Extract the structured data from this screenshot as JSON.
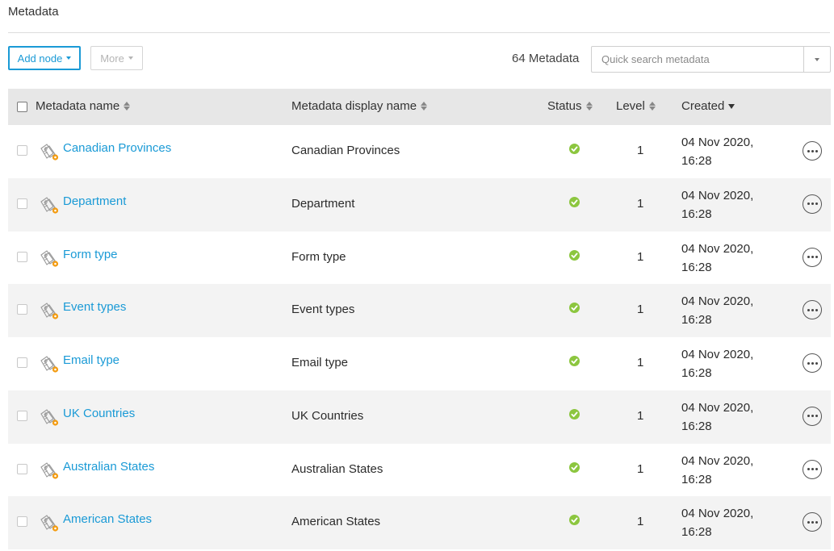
{
  "page": {
    "title": "Metadata"
  },
  "toolbar": {
    "add_node_label": "Add node",
    "more_label": "More",
    "count_label": "64 Metadata",
    "search_placeholder": "Quick search metadata"
  },
  "table": {
    "columns": {
      "name": "Metadata name",
      "display_name": "Metadata display name",
      "status": "Status",
      "level": "Level",
      "created": "Created"
    },
    "sort": {
      "column": "created",
      "direction": "descending"
    },
    "rows": [
      {
        "name": "Canadian Provinces",
        "display_name": "Canadian Provinces",
        "status": "ok",
        "level": "1",
        "created_date": "04 Nov 2020,",
        "created_time": "16:28"
      },
      {
        "name": "Department",
        "display_name": "Department",
        "status": "ok",
        "level": "1",
        "created_date": "04 Nov 2020,",
        "created_time": "16:28"
      },
      {
        "name": "Form type",
        "display_name": "Form type",
        "status": "ok",
        "level": "1",
        "created_date": "04 Nov 2020,",
        "created_time": "16:28"
      },
      {
        "name": "Event types",
        "display_name": "Event types",
        "status": "ok",
        "level": "1",
        "created_date": "04 Nov 2020,",
        "created_time": "16:28"
      },
      {
        "name": "Email type",
        "display_name": "Email type",
        "status": "ok",
        "level": "1",
        "created_date": "04 Nov 2020,",
        "created_time": "16:28"
      },
      {
        "name": "UK Countries",
        "display_name": "UK Countries",
        "status": "ok",
        "level": "1",
        "created_date": "04 Nov 2020,",
        "created_time": "16:28"
      },
      {
        "name": "Australian States",
        "display_name": "Australian States",
        "status": "ok",
        "level": "1",
        "created_date": "04 Nov 2020,",
        "created_time": "16:28"
      },
      {
        "name": "American States",
        "display_name": "American States",
        "status": "ok",
        "level": "1",
        "created_date": "04 Nov 2020,",
        "created_time": "16:28"
      }
    ]
  },
  "icons": {
    "row_icon": "metadata-tag-icon",
    "status_icon": "check-circle-icon",
    "actions_icon": "ellipsis-circle-icon"
  },
  "colors": {
    "accent": "#1a9ad6",
    "status_ok": "#8cc63f",
    "tag_badge": "#f39c12",
    "header_bg": "#e7e7e7",
    "row_alt_bg": "#f3f3f3"
  }
}
